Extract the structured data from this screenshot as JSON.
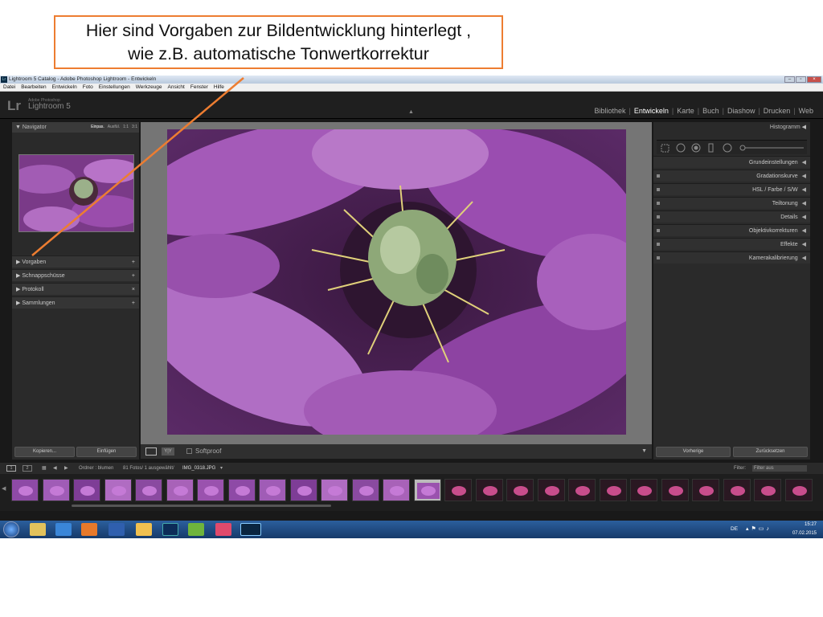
{
  "callout": {
    "line1": "Hier sind Vorgaben zur Bildentwicklung hinterlegt ,",
    "line2": "wie z.B. automatische Tonwertkorrektur",
    "border_color": "#ed7d31"
  },
  "window": {
    "title": "Lightroom 5 Catalog - Adobe Photoshop Lightroom - Entwickeln",
    "icon_text": "Lr",
    "controls": [
      "minimize-icon",
      "maximize-icon",
      "close-icon"
    ]
  },
  "menubar": [
    "Datei",
    "Bearbeiten",
    "Entwickeln",
    "Foto",
    "Einstellungen",
    "Werkzeuge",
    "Ansicht",
    "Fenster",
    "Hilfe"
  ],
  "identity": {
    "logo": "Lr",
    "sub1": "Adobe Photoshop",
    "sub2": "Lightroom 5"
  },
  "modules": {
    "items": [
      "Bibliothek",
      "Entwickeln",
      "Karte",
      "Buch",
      "Diashow",
      "Drucken",
      "Web"
    ],
    "active": "Entwickeln",
    "separator": "|"
  },
  "left_panel": {
    "navigator": {
      "title": "Navigator",
      "options": [
        "Einpas.",
        "Ausfül.",
        "1:1",
        "3:1"
      ],
      "active": "Einpas."
    },
    "sections": [
      {
        "label": "Vorgaben",
        "action": "+"
      },
      {
        "label": "Schnappschüsse",
        "action": "+"
      },
      {
        "label": "Protokoll",
        "action": "×"
      },
      {
        "label": "Sammlungen",
        "action": "+"
      }
    ],
    "copy_button": "Kopieren...",
    "paste_button": "Einfügen"
  },
  "toolbar": {
    "softproof": "Softproof"
  },
  "right_panel": {
    "histogram": "Histogramm",
    "sections": [
      "Grundeinstellungen",
      "Gradationskurve",
      "HSL / Farbe / S/W",
      "Teiltonung",
      "Details",
      "Objektivkorrekturen",
      "Effekte",
      "Kamerakalibrierung"
    ],
    "prev_button": "Vorherige",
    "reset_button": "Zurücksetzen"
  },
  "filmstrip": {
    "pages": [
      "1",
      "2"
    ],
    "source": "Ordner : blumen",
    "count": "81 Fotos/ 1 ausgewählt/",
    "filename": "IMG_0318.JPG",
    "filter_label": "Filter:",
    "filter_value": "Filter aus",
    "thumbnail_count": 26,
    "selected_index": 13
  },
  "taskbar": {
    "lang": "DE",
    "time": "15:27",
    "date": "07.02.2015",
    "apps": [
      "explorer-icon",
      "ie-icon",
      "firefox-icon",
      "word-icon",
      "outlook-icon",
      "photoshop-icon",
      "gift-icon",
      "itunes-icon",
      "lightroom-icon"
    ]
  }
}
